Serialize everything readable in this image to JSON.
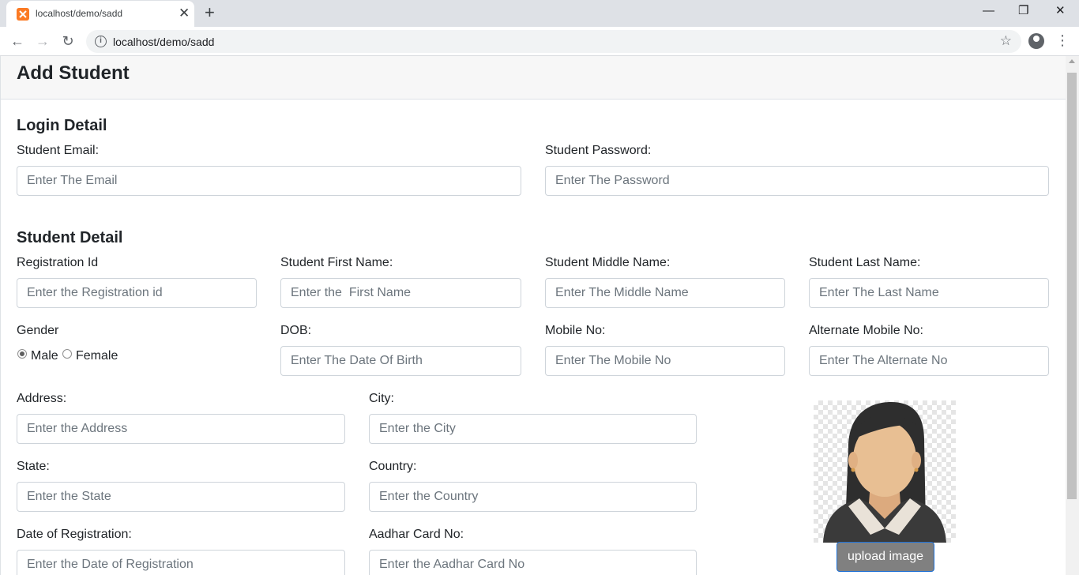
{
  "browser": {
    "tab_title": "localhost/demo/sadd",
    "tab_close": "✕",
    "new_tab": "+",
    "url": "localhost/demo/sadd",
    "window_controls": {
      "minimize": "—",
      "restore": "❐",
      "close": "✕"
    }
  },
  "page": {
    "header_title": "Add Student",
    "login_section": {
      "title": "Login Detail",
      "email_label": "Student Email:",
      "email_placeholder": "Enter The Email",
      "password_label": "Student Password:",
      "password_placeholder": "Enter The Password"
    },
    "student_section": {
      "title": "Student Detail",
      "reg_id_label": "Registration Id",
      "reg_id_placeholder": "Enter the Registration id",
      "first_name_label": "Student First Name:",
      "first_name_placeholder": "Enter the  First Name",
      "middle_name_label": "Student Middle Name:",
      "middle_name_placeholder": "Enter The Middle Name",
      "last_name_label": "Student Last Name:",
      "last_name_placeholder": "Enter The Last Name",
      "gender_label": "Gender",
      "gender_options": [
        "Male",
        "Female"
      ],
      "gender_selected": "Male",
      "dob_label": "DOB:",
      "dob_placeholder": "Enter The Date Of Birth",
      "mobile_label": "Mobile No:",
      "mobile_placeholder": "Enter The Mobile No",
      "alt_mobile_label": "Alternate Mobile No:",
      "alt_mobile_placeholder": "Enter The Alternate No",
      "address_label": "Address:",
      "address_placeholder": "Enter the Address",
      "city_label": "City:",
      "city_placeholder": "Enter the City",
      "state_label": "State:",
      "state_placeholder": "Enter the State",
      "country_label": "Country:",
      "country_placeholder": "Enter the Country",
      "reg_date_label": "Date of Registration:",
      "reg_date_placeholder": "Enter the Date of Registration",
      "aadhar_label": "Aadhar Card No:",
      "aadhar_placeholder": "Enter the Aadhar Card No",
      "upload_button": "upload image"
    }
  },
  "colors": {
    "accent": "#1d70d6",
    "favicon": "#fb7a24",
    "upload_bg": "#808080"
  }
}
